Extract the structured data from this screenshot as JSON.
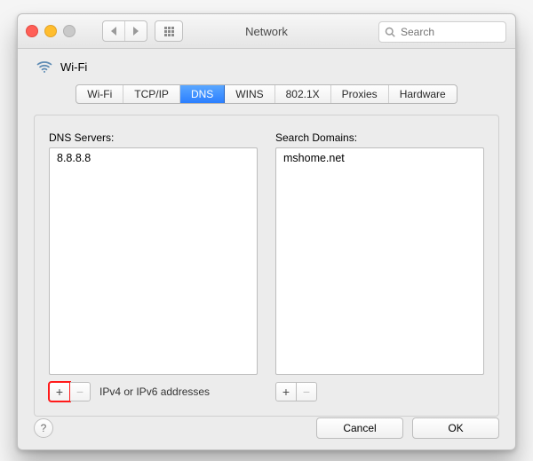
{
  "window": {
    "title": "Network"
  },
  "search": {
    "placeholder": "Search"
  },
  "connection": {
    "name": "Wi-Fi"
  },
  "tabs": [
    {
      "label": "Wi-Fi",
      "active": false
    },
    {
      "label": "TCP/IP",
      "active": false
    },
    {
      "label": "DNS",
      "active": true
    },
    {
      "label": "WINS",
      "active": false
    },
    {
      "label": "802.1X",
      "active": false
    },
    {
      "label": "Proxies",
      "active": false
    },
    {
      "label": "Hardware",
      "active": false
    }
  ],
  "dns": {
    "label": "DNS Servers:",
    "entries": [
      "8.8.8.8"
    ],
    "hint": "IPv4 or IPv6 addresses"
  },
  "search_domains": {
    "label": "Search Domains:",
    "entries": [
      "mshome.net"
    ]
  },
  "buttons": {
    "cancel": "Cancel",
    "ok": "OK"
  },
  "colors": {
    "accent": "#2b7fff",
    "highlight": "#ff1a1a"
  }
}
